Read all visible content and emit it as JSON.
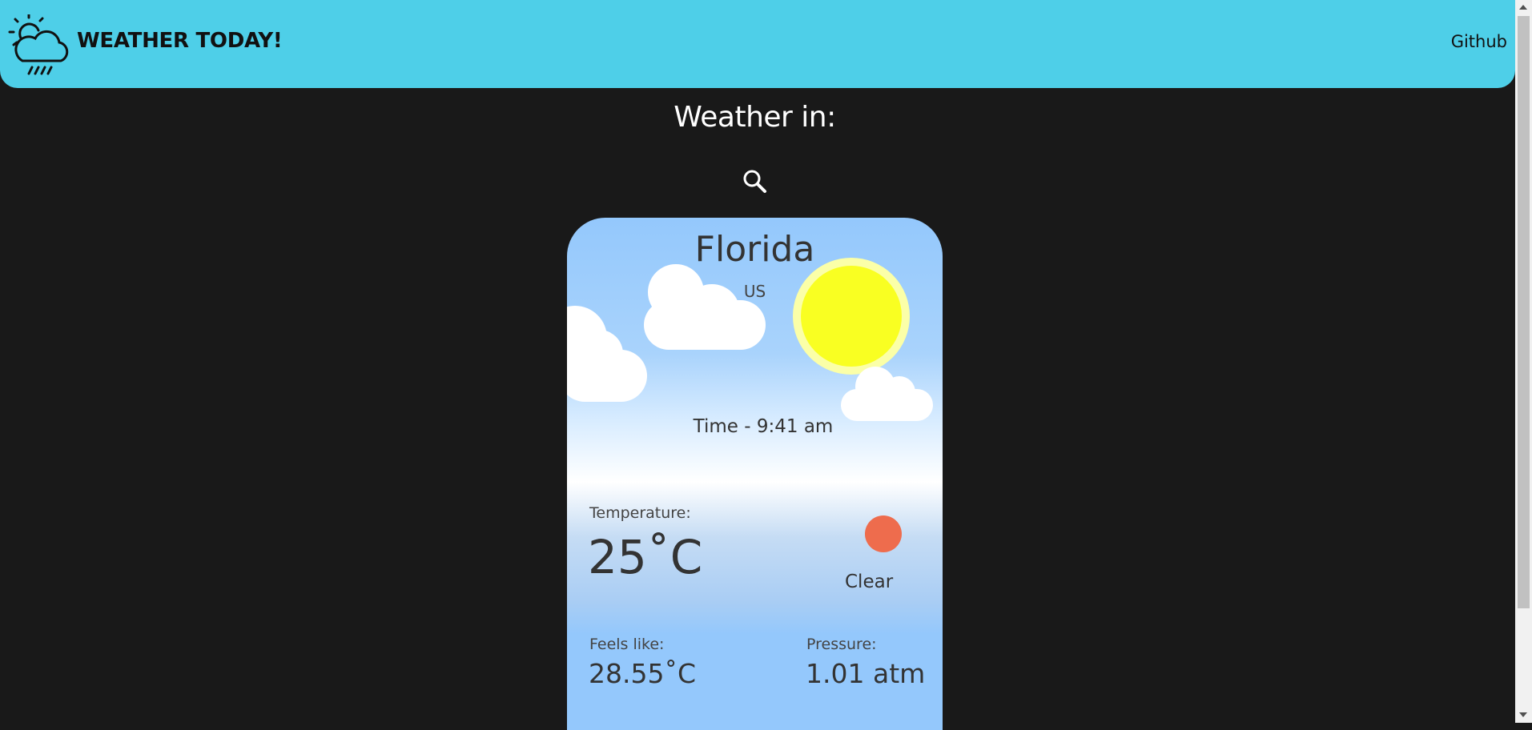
{
  "header": {
    "brand": "WEATHER TODAY!",
    "link": "Github",
    "logo_icon": "cloud-sun-rain-icon"
  },
  "search": {
    "heading": "Weather in:",
    "icon": "search-icon"
  },
  "card": {
    "city": "Florida",
    "country": "US",
    "time": "Time - 9:41 am",
    "temperature_label": "Temperature:",
    "temperature": "25˚C",
    "condition": "Clear",
    "feels_label": "Feels like:",
    "feels_value": "28.55˚C",
    "pressure_label": "Pressure:",
    "pressure_value": "1.01 atm"
  },
  "colors": {
    "header": "#4ecfe8",
    "background": "#191919",
    "sun": "#f9ff22",
    "condition_dot": "#ee6c4d"
  }
}
